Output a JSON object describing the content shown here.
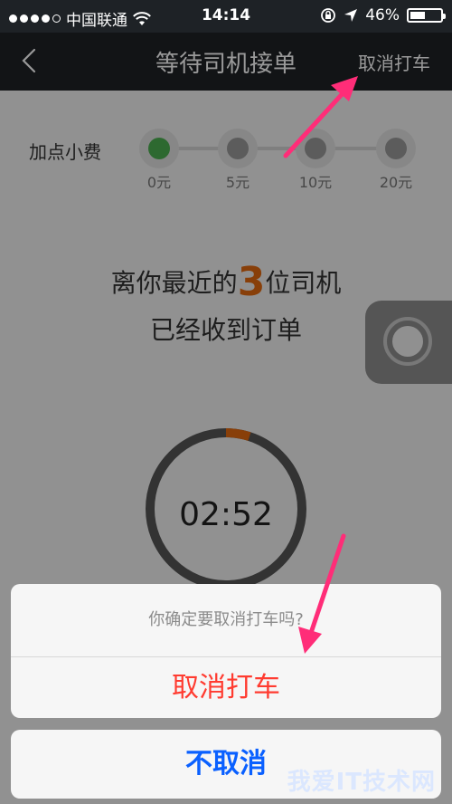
{
  "status_bar": {
    "carrier": "中国联通",
    "time": "14:14",
    "battery": "46%"
  },
  "nav": {
    "title": "等待司机接单",
    "cancel_ride": "取消打车"
  },
  "tip": {
    "label": "加点小费",
    "options": [
      "0元",
      "5元",
      "10元",
      "20元"
    ],
    "selected": "0元"
  },
  "message": {
    "line1_prefix": "离你最近的",
    "driver_count": "3",
    "line1_suffix": "位司机",
    "line2": "已经收到订单"
  },
  "timer": {
    "display": "02:52",
    "progress": 0.05
  },
  "dialog": {
    "question": "你确定要取消打车吗?",
    "confirm_label": "取消打车",
    "dismiss_label": "不取消"
  },
  "colors": {
    "accent_green": "#4caf50",
    "accent_orange": "#e36a10",
    "danger_red": "#ff3b30",
    "ios_blue": "#0a60ff",
    "arrow_pink": "#ff2d78"
  },
  "watermark": "我爱IT技术网"
}
